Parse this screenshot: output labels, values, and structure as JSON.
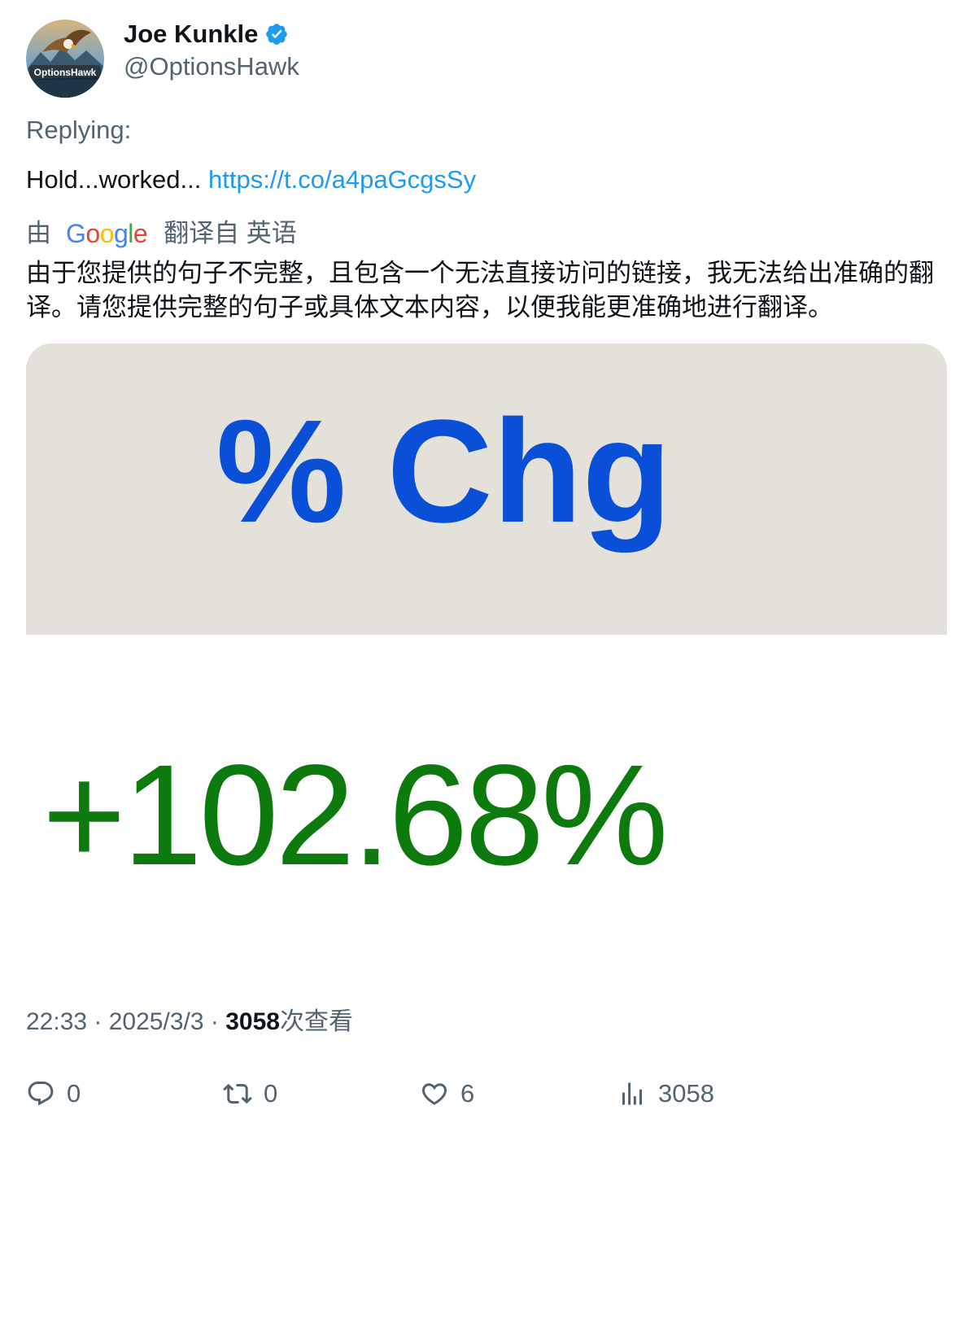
{
  "author": {
    "display_name": "Joe Kunkle",
    "handle": "@OptionsHawk",
    "verified": true,
    "avatar_label": "OptionsHawk"
  },
  "replying_label": "Replying:",
  "tweet": {
    "text": "Hold...worked... ",
    "link": "https://t.co/a4paGcgsSy"
  },
  "translation": {
    "by": "由",
    "provider": "Google",
    "from_label": "翻译自 英语",
    "text": "由于您提供的句子不完整，且包含一个无法直接访问的链接，我无法给出准确的翻译。请您提供完整的句子或具体文本内容，以便我能更准确地进行翻译。"
  },
  "media": {
    "header": "% Chg",
    "value": "+102.68%",
    "header_color": "#0a4fd8",
    "value_color": "#0c7a0c"
  },
  "meta": {
    "time": "22:33",
    "separator": " · ",
    "date": "2025/3/3",
    "views_count": "3058",
    "views_label": "次查看"
  },
  "actions": {
    "replies": "0",
    "retweets": "0",
    "likes": "6",
    "views": "3058"
  },
  "icons": {
    "verified": "verified-badge-icon",
    "reply": "reply-icon",
    "retweet": "retweet-icon",
    "like": "heart-icon",
    "views": "analytics-icon"
  },
  "colors": {
    "link": "#1d9bf0",
    "secondary_text": "#536471",
    "primary_text": "#0f1419"
  }
}
